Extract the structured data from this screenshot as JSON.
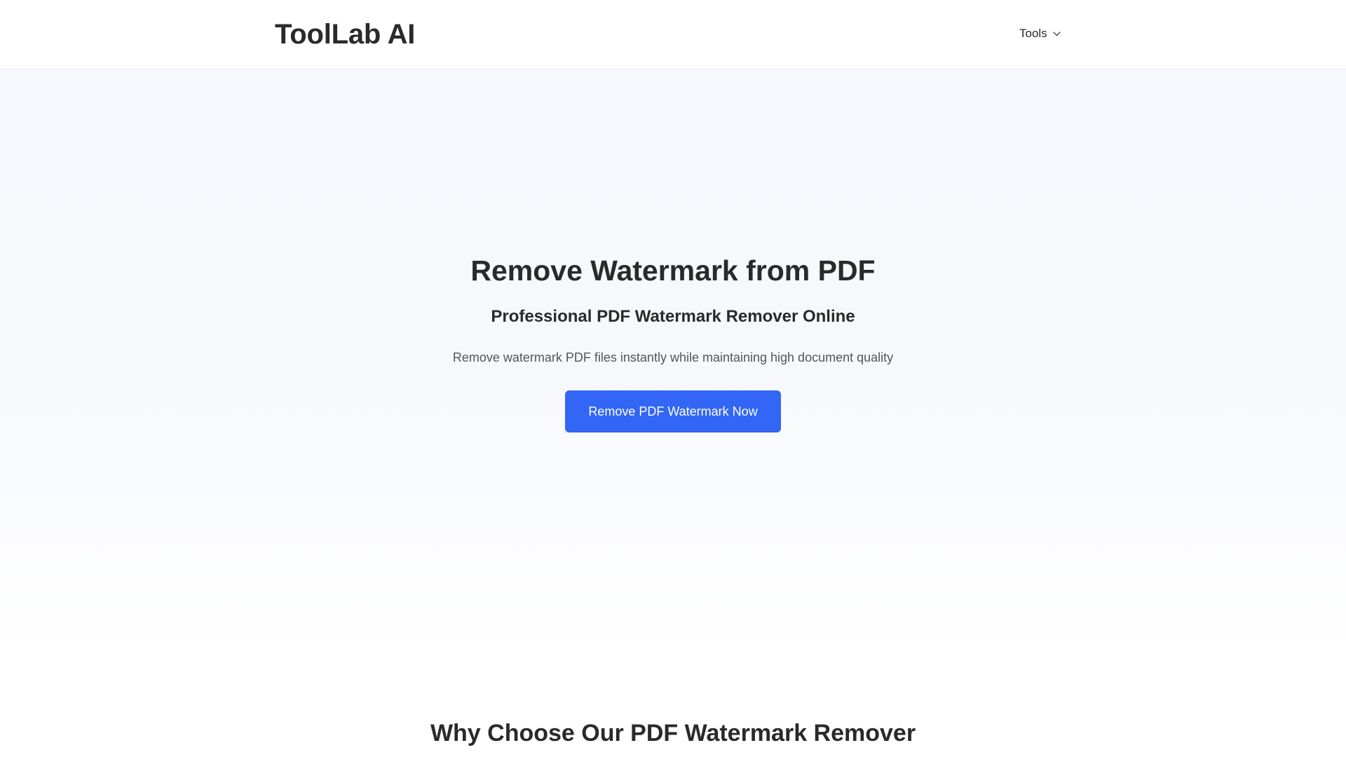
{
  "header": {
    "logo": "ToolLab AI",
    "nav": {
      "tools_label": "Tools",
      "tools_icon": "chevron-down-icon"
    }
  },
  "hero": {
    "title": "Remove Watermark from PDF",
    "subtitle": "Professional PDF Watermark Remover Online",
    "description": "Remove watermark PDF files instantly while maintaining high document quality",
    "cta_label": "Remove PDF Watermark Now"
  },
  "features": {
    "title": "Why Choose Our PDF Watermark Remover"
  },
  "colors": {
    "accent": "#3366f5",
    "text": "#2a2a2a",
    "muted": "#555555",
    "hero_bg": "#f6f8fd"
  }
}
